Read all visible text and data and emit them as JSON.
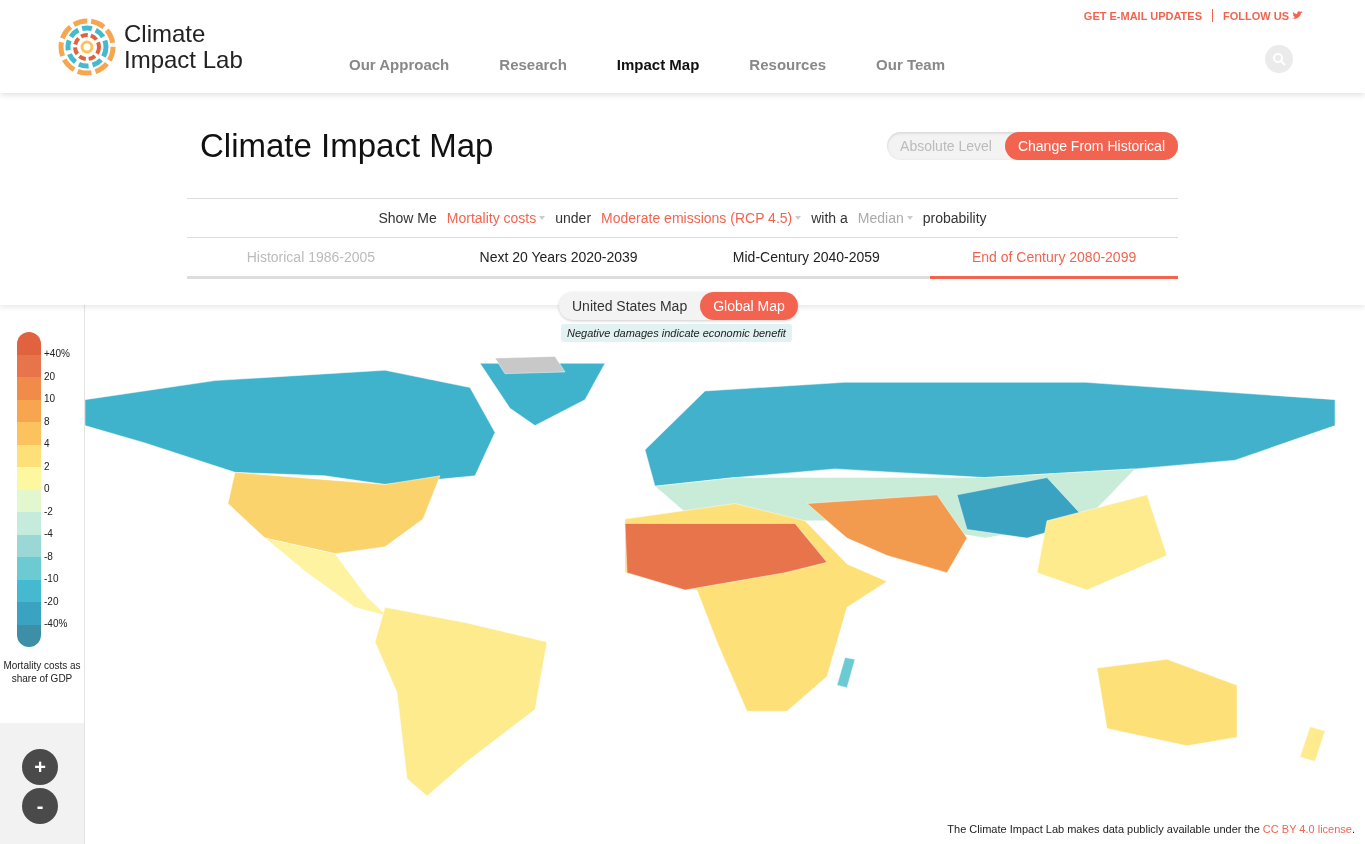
{
  "header": {
    "logo": "Climate Impact Lab",
    "top_links": [
      {
        "label": "GET E-MAIL UPDATES",
        "kind": "text"
      },
      {
        "label": "FOLLOW US",
        "kind": "twitter"
      }
    ],
    "nav": [
      {
        "label": "Our Approach",
        "selected": false
      },
      {
        "label": "Research",
        "selected": false
      },
      {
        "label": "Impact Map",
        "selected": true
      },
      {
        "label": "Resources",
        "selected": false
      },
      {
        "label": "Our Team",
        "selected": false
      }
    ]
  },
  "title": "Climate Impact Map",
  "level_toggle": [
    {
      "label": "Absolute Level",
      "selected": false
    },
    {
      "label": "Change From Historical",
      "selected": true
    }
  ],
  "query": [
    {
      "kind": "text",
      "label": "Show Me"
    },
    {
      "kind": "dropdown",
      "label": "Mortality costs",
      "disabled": false
    },
    {
      "kind": "text",
      "label": "under"
    },
    {
      "kind": "dropdown",
      "label": "Moderate emissions (RCP 4.5)",
      "disabled": false
    },
    {
      "kind": "text",
      "label": "with a"
    },
    {
      "kind": "dropdown",
      "label": "Median",
      "disabled": true
    },
    {
      "kind": "text",
      "label": "probability"
    }
  ],
  "periods": [
    {
      "label": "Historical 1986-2005",
      "selected": false,
      "disabled": true
    },
    {
      "label": "Next 20 Years 2020-2039",
      "selected": false,
      "disabled": false
    },
    {
      "label": "Mid-Century 2040-2059",
      "selected": false,
      "disabled": false
    },
    {
      "label": "End of Century 2080-2099",
      "selected": true,
      "disabled": false
    }
  ],
  "map_toggle": [
    {
      "label": "United States Map",
      "selected": false
    },
    {
      "label": "Global Map",
      "selected": true
    }
  ],
  "map_note": "Negative damages indicate economic benefit",
  "legend": {
    "labels": [
      "+40%",
      "20",
      "10",
      "8",
      "4",
      "2",
      "0",
      "-2",
      "-4",
      "-8",
      "-10",
      "-20",
      "-40%"
    ],
    "title": "Mortality costs as share of GDP"
  },
  "zoom": [
    "+",
    "-"
  ],
  "license": {
    "text": "The Climate Impact Lab makes data publicly available under the",
    "link": "CC BY 4.0 license",
    "end": "."
  }
}
